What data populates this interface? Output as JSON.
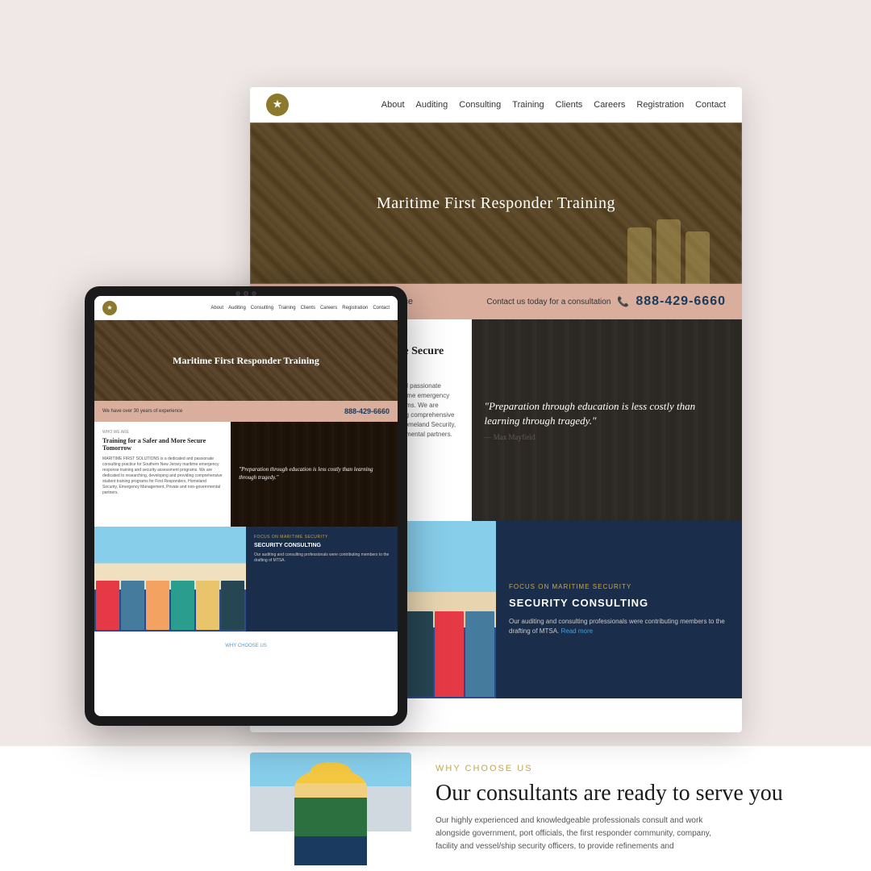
{
  "site": {
    "logo_text": "★",
    "nav": {
      "links": [
        "About",
        "Auditing",
        "Consulting",
        "Training",
        "Clients",
        "Careers",
        "Registration",
        "Contact"
      ]
    },
    "hero": {
      "title": "Maritime First Responder Training"
    },
    "cta_bar": {
      "experience_text": "We have over 30 years of experience",
      "contact_text": "Contact us today for a consultation",
      "phone": "888-429-6660"
    },
    "who_we_are": {
      "label": "WHO WE ARE",
      "heading": "Training for a Safer and More Secure Tomorrow",
      "body": "MARITIME FIRST SOLUTIONS is a dedicated and passionate consulting practice for Southern New Jersey maritime emergency response training and security assessment programs. We are dedicated to researching, developing and providing comprehensive student training programs for First Responders, Homeland Security, Emergency Management, Private and non-governmental partners."
    },
    "quote": {
      "text": "\"Preparation through education is less costly than learning through tragedy.\"",
      "attribution": "— Max Mayfield"
    },
    "security": {
      "focus_label": "FOCUS ON MARITIME SECURITY",
      "heading": "SECURITY CONSULTING",
      "body": "Our auditing and consulting professionals were contributing members to the drafting of MTSA.",
      "read_more": "Read more"
    },
    "why_choose_us": {
      "label": "WHY CHOOSE US",
      "heading": "Our consultants are ready to serve you",
      "body": "Our highly experienced and knowledgeable professionals consult and work alongside government, port officials, the first responder community, company, facility and vessel/ship security officers, to provide refinements and"
    }
  }
}
